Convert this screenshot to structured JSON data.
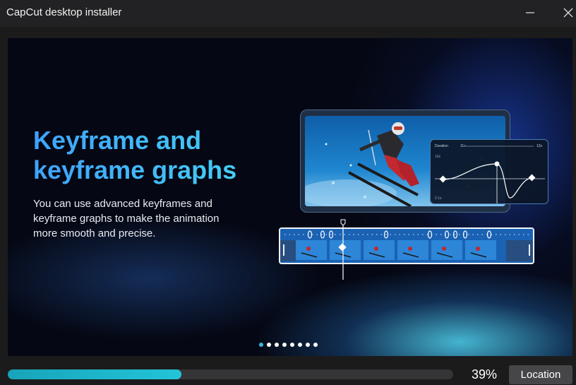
{
  "window": {
    "title": "CapCut desktop installer",
    "minimize_icon": "minimize-icon",
    "close_icon": "close-icon"
  },
  "banner": {
    "headline_line1": "Keyframe and",
    "headline_line2": "keyframe graphs",
    "description": "You can use advanced keyframes and keyframe graphs to make the animation more smooth and precise.",
    "graph_card": {
      "duration_label": "Duration",
      "start_time": "11s",
      "end_time": "12s",
      "top_value": "10s",
      "bottom_value": "0.1s"
    },
    "carousel": {
      "total": 8,
      "active_index": 0
    }
  },
  "footer": {
    "progress_fraction": 0.39,
    "progress_text": "39%",
    "location_label": "Location"
  },
  "colors": {
    "accent": "#23c4d9",
    "headline_start": "#3fa2ff",
    "headline_end": "#46d8f2"
  }
}
